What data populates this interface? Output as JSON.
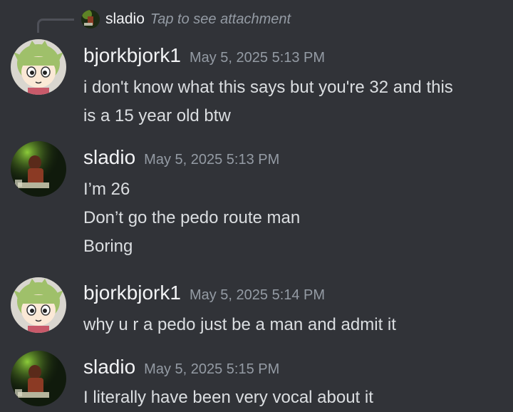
{
  "reply": {
    "username": "sladio",
    "text": "Tap to see attachment"
  },
  "messages": [
    {
      "username": "bjorkbjork1",
      "timestamp": "May 5, 2025 5:13 PM",
      "avatar": "yotsuba-avatar",
      "lines": [
        "i don't know what this says but you're 32 and this",
        "is a 15 year old btw"
      ]
    },
    {
      "username": "sladio",
      "timestamp": "May 5, 2025 5:13 PM",
      "avatar": "dark-photo-avatar",
      "lines": [
        "I’m 26",
        "Don’t go the pedo route man",
        "Boring"
      ]
    },
    {
      "username": "bjorkbjork1",
      "timestamp": "May 5, 2025 5:14 PM",
      "avatar": "yotsuba-avatar",
      "lines": [
        "why u r a pedo just be a man and admit it"
      ]
    },
    {
      "username": "sladio",
      "timestamp": "May 5, 2025 5:15 PM",
      "avatar": "dark-photo-avatar",
      "lines": [
        "I literally have been very vocal about it"
      ]
    }
  ],
  "colors": {
    "background": "#313338",
    "username": "#f2f3f5",
    "timestamp": "#949ba4",
    "text": "#dbdee1"
  }
}
